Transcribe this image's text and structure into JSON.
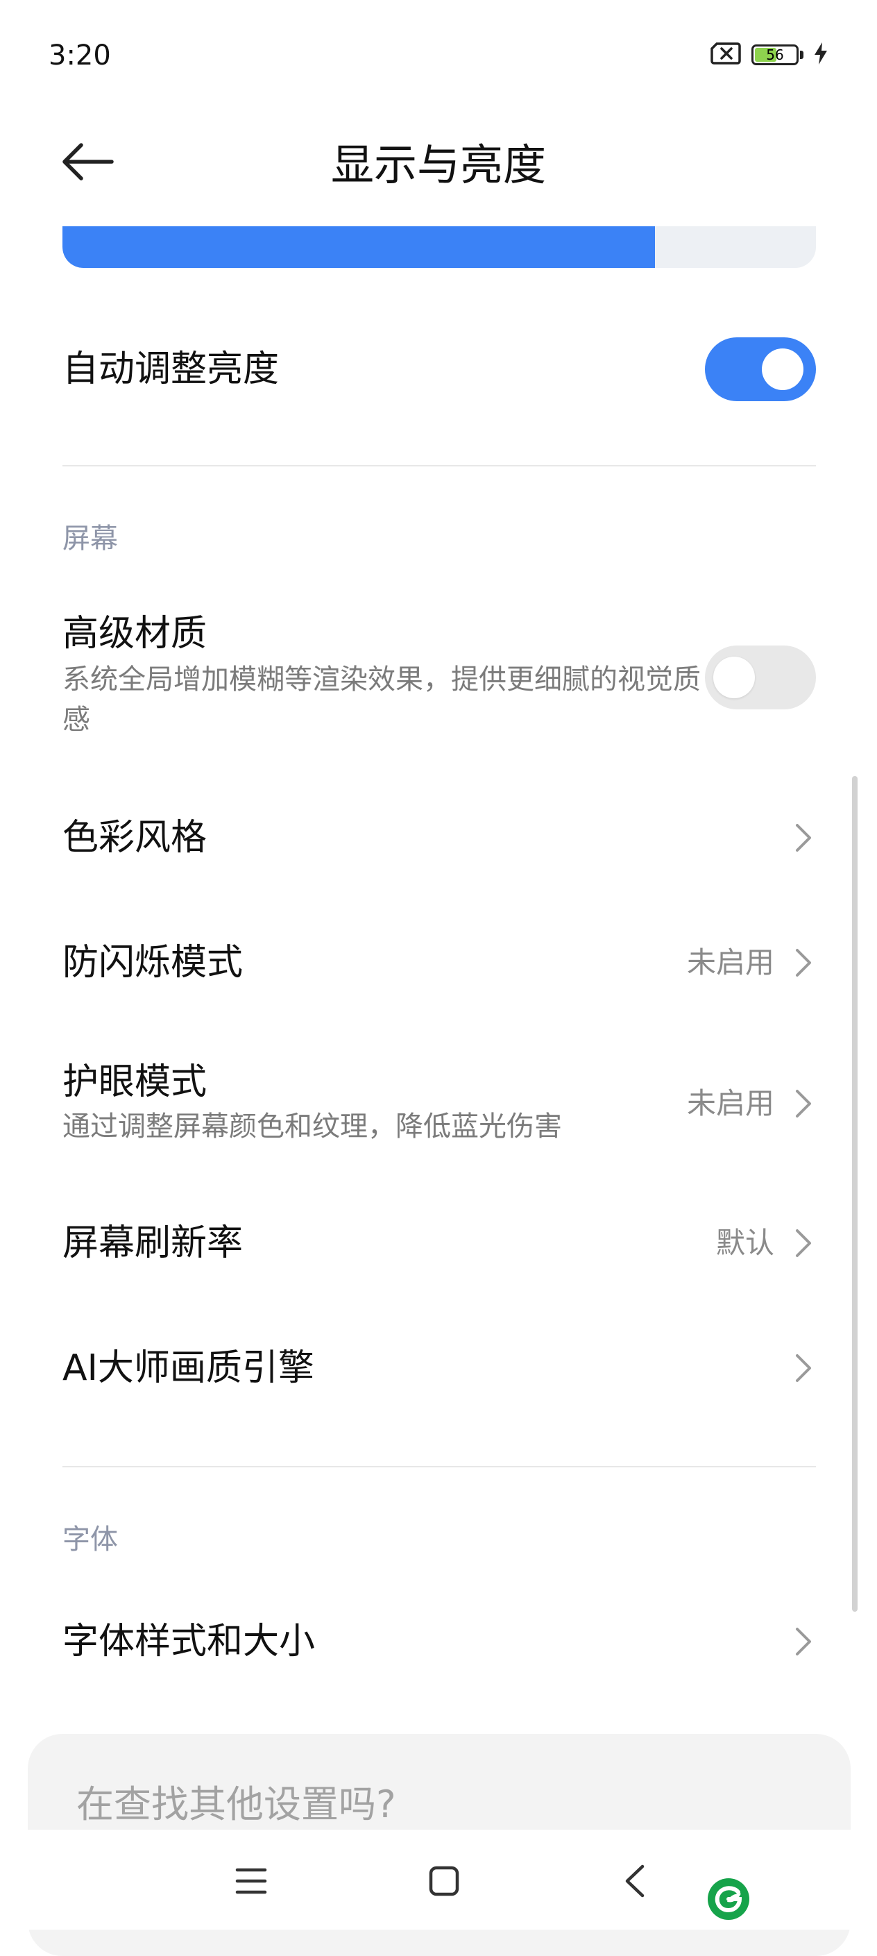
{
  "status_bar": {
    "time": "3:20",
    "battery_level": "56",
    "icons": [
      "sim-no-signal-icon",
      "battery-icon",
      "charging-icon"
    ]
  },
  "header": {
    "title": "显示与亮度",
    "back_icon": "back-arrow-icon"
  },
  "brightness": {
    "level": 0.786
  },
  "auto_brightness": {
    "label": "自动调整亮度",
    "enabled": true
  },
  "sections": {
    "screen": {
      "header": "屏幕",
      "advanced_material": {
        "label": "高级材质",
        "description": "系统全局增加模糊等渲染效果，提供更细腻的视觉质感",
        "enabled": false
      },
      "color_style": {
        "label": "色彩风格"
      },
      "anti_flicker": {
        "label": "防闪烁模式",
        "value": "未启用"
      },
      "eye_care": {
        "label": "护眼模式",
        "description": "通过调整屏幕颜色和纹理，降低蓝光伤害",
        "value": "未启用"
      },
      "refresh_rate": {
        "label": "屏幕刷新率",
        "value": "默认"
      },
      "ai_engine": {
        "label": "AI大师画质引擎"
      }
    },
    "font": {
      "header": "字体",
      "font_style": {
        "label": "字体样式和大小"
      }
    }
  },
  "search_card": {
    "text": "在查找其他设置吗?"
  },
  "nav_bar": {
    "icons": [
      "menu-icon",
      "home-icon",
      "back-icon"
    ]
  },
  "colors": {
    "accent": "#3b82f6",
    "section_header": "#8e95a8",
    "secondary_text": "#7b7b7b",
    "toggle_off": "#e8e8e8"
  }
}
